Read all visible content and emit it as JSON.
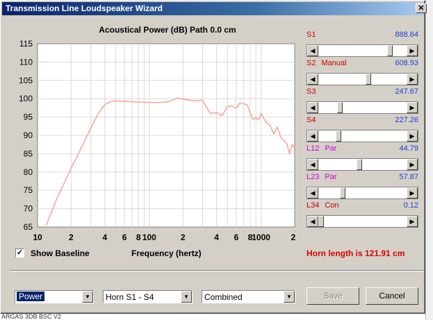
{
  "window": {
    "title": "Transmission Line Loudspeaker Wizard",
    "close_glyph": "✕"
  },
  "background": {
    "partial_text": "ARGAS 3DB  BSC  V2"
  },
  "chart_header": "Acoustical Power (dB)   Path 0.0 cm",
  "chart_data": {
    "type": "line",
    "title": "Acoustical Power (dB)   Path 0.0 cm",
    "xlabel": "Frequency (hertz)",
    "ylabel": "",
    "x_scale": "log",
    "xlim": [
      10,
      2000
    ],
    "ylim": [
      65,
      115
    ],
    "x_ticks": [
      10,
      20,
      40,
      60,
      80,
      100,
      200,
      400,
      600,
      800,
      1000,
      2000
    ],
    "x_tick_labels": [
      "10",
      "2",
      "4",
      "6",
      "8",
      "100",
      "2",
      "4",
      "6",
      "8",
      "1000",
      "2"
    ],
    "y_ticks": [
      65,
      70,
      75,
      80,
      85,
      90,
      95,
      100,
      105,
      110,
      115
    ],
    "grid": true,
    "series": [
      {
        "color": "#f4a8a0",
        "x": [
          12,
          15,
          20,
          25,
          30,
          35,
          40,
          45,
          50,
          60,
          70,
          80,
          100,
          120,
          150,
          180,
          200,
          220,
          260,
          300,
          320,
          350,
          400,
          450,
          500,
          550,
          600,
          650,
          700,
          750,
          800,
          850,
          900,
          950,
          1000,
          1100,
          1200,
          1300,
          1400,
          1500,
          1600,
          1700,
          1800,
          1900,
          2000
        ],
        "y": [
          65.5,
          73,
          81,
          87,
          92,
          96,
          98.4,
          99.2,
          99.4,
          99.3,
          99.2,
          99.1,
          99,
          98.9,
          99.2,
          100.2,
          99.9,
          99.7,
          99.4,
          99.6,
          98,
          96,
          96.2,
          95.4,
          97.9,
          98,
          97.4,
          98.9,
          98.6,
          98.4,
          96.2,
          94.3,
          94.8,
          94.2,
          96,
          93.7,
          92.8,
          90.4,
          92.3,
          89.5,
          88.7,
          87.7,
          85,
          87.5,
          86.5
        ]
      }
    ]
  },
  "sliders": [
    {
      "label": "S1",
      "sub": "",
      "label_color": "red",
      "value": "888.64",
      "fraction": 0.83
    },
    {
      "label": "S2",
      "sub": "Manual",
      "label_color": "red",
      "value": "608.93",
      "fraction": 0.57
    },
    {
      "label": "S3",
      "sub": "",
      "label_color": "red",
      "value": "247.67",
      "fraction": 0.23
    },
    {
      "label": "S4",
      "sub": "",
      "label_color": "red",
      "value": "227.26",
      "fraction": 0.21
    },
    {
      "label": "L12",
      "sub": "Par",
      "label_color": "magenta",
      "value": "44.79",
      "fraction": 0.46
    },
    {
      "label": "L23",
      "sub": "Par",
      "label_color": "magenta",
      "value": "57.87",
      "fraction": 0.26
    },
    {
      "label": "L34",
      "sub": "Con",
      "label_color": "red",
      "value": "0.12",
      "fraction": 0.0
    }
  ],
  "show_baseline": {
    "label": "Show Baseline",
    "checked_glyph": "✓"
  },
  "frequency_label": "Frequency (hertz)",
  "horn_length": "Horn length is 121.91 cm",
  "dropdowns": {
    "mode": {
      "value": "Power"
    },
    "section": {
      "value": "Horn S1 - S4"
    },
    "view": {
      "value": "Combined"
    }
  },
  "buttons": {
    "save": "Save",
    "cancel": "Cancel"
  },
  "glyphs": {
    "arrow_left": "◀",
    "arrow_right": "▶",
    "arrow_down": "▼"
  }
}
